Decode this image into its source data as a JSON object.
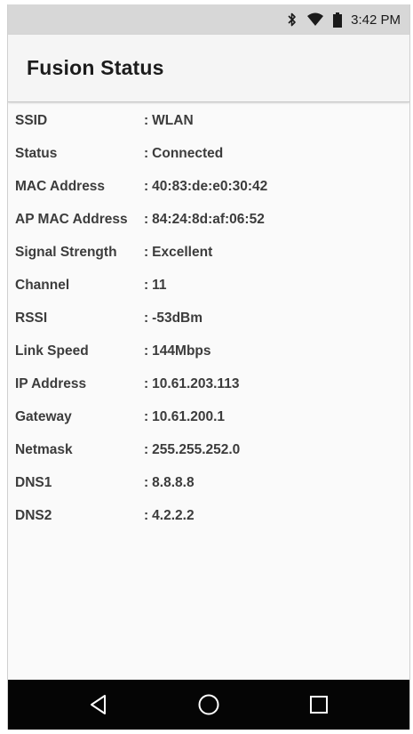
{
  "status_bar": {
    "time": "3:42 PM",
    "icons": [
      "bluetooth-icon",
      "wifi-icon",
      "battery-icon"
    ]
  },
  "app_bar": {
    "title": "Fusion Status"
  },
  "separator": ":",
  "rows": [
    {
      "label": "SSID",
      "value": "WLAN"
    },
    {
      "label": "Status",
      "value": "Connected"
    },
    {
      "label": "MAC Address",
      "value": "40:83:de:e0:30:42"
    },
    {
      "label": "AP MAC Address",
      "value": "84:24:8d:af:06:52"
    },
    {
      "label": "Signal Strength",
      "value": "Excellent"
    },
    {
      "label": "Channel",
      "value": "11"
    },
    {
      "label": "RSSI",
      "value": "-53dBm"
    },
    {
      "label": "Link Speed",
      "value": "144Mbps"
    },
    {
      "label": "IP Address",
      "value": "10.61.203.113"
    },
    {
      "label": "Gateway",
      "value": "10.61.200.1"
    },
    {
      "label": "Netmask",
      "value": "255.255.252.0"
    },
    {
      "label": "DNS1",
      "value": "8.8.8.8"
    },
    {
      "label": "DNS2",
      "value": "4.2.2.2"
    }
  ],
  "nav_bar": {
    "buttons": [
      "back-icon",
      "home-icon",
      "recents-icon"
    ]
  },
  "colors": {
    "status_bar_bg": "#d7d7d7",
    "app_bar_bg": "#f5f5f5",
    "nav_bar_bg": "#050505",
    "text": "#3c3c3c"
  }
}
